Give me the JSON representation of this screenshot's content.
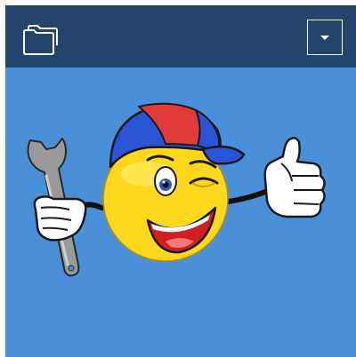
{
  "header": {
    "background": "#23456b",
    "folder_icon": "folder-icon",
    "dropdown_icon": "caret-down-icon"
  },
  "content": {
    "background": "#4a90d9",
    "illustration": "winking-smiley-mechanic-with-wrench-and-thumbs-up"
  }
}
